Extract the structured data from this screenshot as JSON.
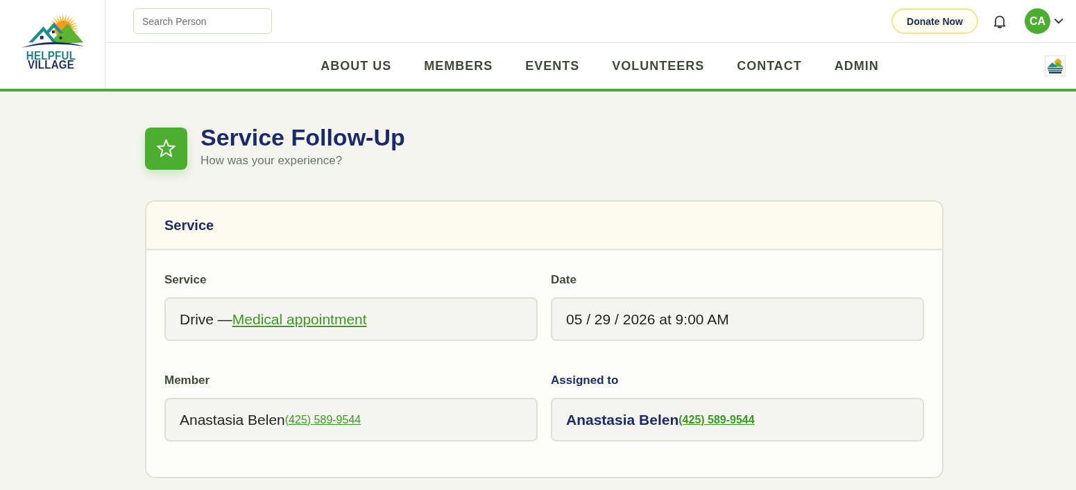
{
  "header": {
    "logo": {
      "lines": [
        "HELPFUL",
        "VILLAGE"
      ]
    },
    "search": {
      "placeholder": "Search Person"
    },
    "donate_button": "Donate Now",
    "avatar": {
      "initials": "CA"
    }
  },
  "nav": [
    "ABOUT US",
    "MEMBERS",
    "EVENTS",
    "VOLUNTEERS",
    "CONTACT",
    "ADMIN"
  ],
  "page": {
    "title": "Service Follow-Up",
    "subtitle": "How was your experience?"
  },
  "card": {
    "title": "Service",
    "fields": [
      {
        "label": "Service",
        "kind": "service",
        "value": "Drive —",
        "link": "Medical appointment"
      },
      {
        "label": "Date",
        "kind": "text",
        "value": "05 / 29 / 2026 at 9:00 AM"
      },
      {
        "label": "Member",
        "kind": "contact",
        "value": "Anastasia Belen",
        "link": "(425) 589-9544"
      },
      {
        "label": "Assigned to",
        "kind": "assignee",
        "value": "Anastasia Belen",
        "link": "(425) 589-9544"
      }
    ]
  }
}
